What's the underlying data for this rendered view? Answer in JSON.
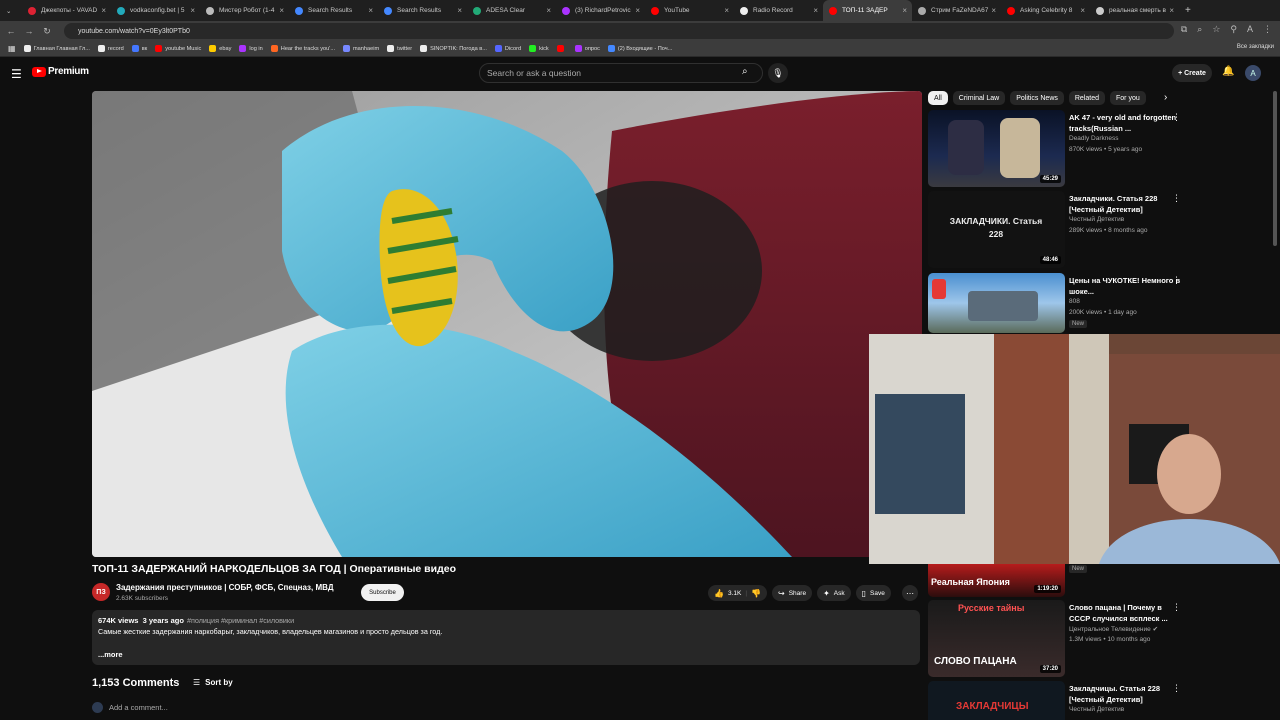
{
  "browser": {
    "tabs": [
      {
        "label": "Джекпоты - VAVAD",
        "color": "#d23"
      },
      {
        "label": "vodkaconfig.bet | 5",
        "color": "#2ab"
      },
      {
        "label": "Мистер Робот (1-4",
        "color": "#bbb"
      },
      {
        "label": "Search Results",
        "color": "#48f"
      },
      {
        "label": "Search Results",
        "color": "#48f"
      },
      {
        "label": "ADESA Clear",
        "color": "#2a7"
      },
      {
        "label": "(3) RichardPetrovic",
        "color": "#a3f"
      },
      {
        "label": "YouTube",
        "color": "#f00"
      },
      {
        "label": "Radio Record",
        "color": "#eee"
      },
      {
        "label": "ТОП-11 ЗАДЕР",
        "color": "#f00"
      },
      {
        "label": "Стрим FaZeNDA67",
        "color": "#aaa"
      },
      {
        "label": "Asking Celebrity 8",
        "color": "#f00"
      },
      {
        "label": "реальная смерть в",
        "color": "#ccc"
      }
    ],
    "active_tab": 9,
    "url": "youtube.com/watch?v=0Ey3lt0PTb0",
    "bookmarks": [
      {
        "label": "Главная Главная Гл...",
        "color": "#eee"
      },
      {
        "label": "record",
        "color": "#eee"
      },
      {
        "label": "вк",
        "color": "#47f"
      },
      {
        "label": "youtube Music",
        "color": "#f00"
      },
      {
        "label": "ebay",
        "color": "#fc0"
      },
      {
        "label": "log in",
        "color": "#a3f"
      },
      {
        "label": "Hear the tracks you'...",
        "color": "#f62"
      },
      {
        "label": "manhaeim",
        "color": "#78f"
      },
      {
        "label": "twitter",
        "color": "#eee"
      },
      {
        "label": "SINOPTIK: Погода в...",
        "color": "#eee"
      },
      {
        "label": "Dicord",
        "color": "#56f"
      },
      {
        "label": "kick",
        "color": "#2e2"
      },
      {
        "label": "",
        "color": "#f00"
      },
      {
        "label": "опрос",
        "color": "#a3f"
      },
      {
        "label": "(2) Входящие - Поч...",
        "color": "#48f"
      }
    ],
    "all_bookmarks": "Все закладки"
  },
  "masthead": {
    "logo_text": "Premium",
    "search_placeholder": "Search or ask a question",
    "create_label": "Create"
  },
  "video": {
    "title": "ТОП-11 ЗАДЕРЖАНИЙ НАРКОДЕЛЬЦОВ ЗА ГОД | Оперативные видео",
    "channel": "Задержания преступников | СОБР, ФСБ, Спецназ, МВД",
    "channel_initials": "ПЗ",
    "subscribers": "2.63K subscribers",
    "subscribe_label": "Subscribe",
    "likes": "3.1K",
    "share_label": "Share",
    "ask_label": "Ask",
    "save_label": "Save",
    "views": "674K views",
    "age": "3 years ago",
    "tags": "#полиция #криминал #силовики",
    "description": "Самые жесткие задержания наркобарыг, закладчиков, владельцев магазинов и просто дельцов за год.",
    "more_label": "...more"
  },
  "comments": {
    "count": "1,153 Comments",
    "sort_label": "Sort by",
    "add_placeholder": "Add a comment..."
  },
  "sidebar": {
    "chips": [
      "All",
      "Criminal Law",
      "Politics News",
      "Related",
      "For you"
    ],
    "recs": [
      {
        "title": "AK 47 - very old and forgotten tracks(Russian ...",
        "channel": "Deadly Darkness",
        "meta": "870K views • 5 years ago",
        "duration": "45:29",
        "new": ""
      },
      {
        "title": "Закладчики. Статья 228 [Честный Детектив]",
        "channel": "Честный Детектив",
        "meta": "289K views • 8 months ago",
        "duration": "48:46",
        "new": ""
      },
      {
        "title": "Цены на ЧУКОТКЕ! Немного в шоке...",
        "channel": "808",
        "meta": "200K views • 1 day ago",
        "duration": "",
        "new": "New"
      },
      {
        "title": "",
        "channel": "",
        "meta": "",
        "duration": "1:19:20",
        "new": "New",
        "thumb_text": "Реальная Япония"
      },
      {
        "title": "Слово пацана | Почему в СССР случился всплеск ...",
        "channel": "Центральное Телевидение",
        "meta": "1.3M views • 10 months ago",
        "duration": "37:20",
        "new": "",
        "thumb_text": "СЛОВО ПАЦАНА",
        "thumb_top": "Русские тайны"
      },
      {
        "title": "Закладчицы. Статья 228 [Честный Детектив]",
        "channel": "Честный Детектив",
        "meta": "",
        "duration": "",
        "new": "",
        "thumb_text": "ЗАКЛАДЧИЦЫ"
      }
    ],
    "rec2_thumb_text": "ЗАКЛАДЧИКИ. Статья 228"
  }
}
